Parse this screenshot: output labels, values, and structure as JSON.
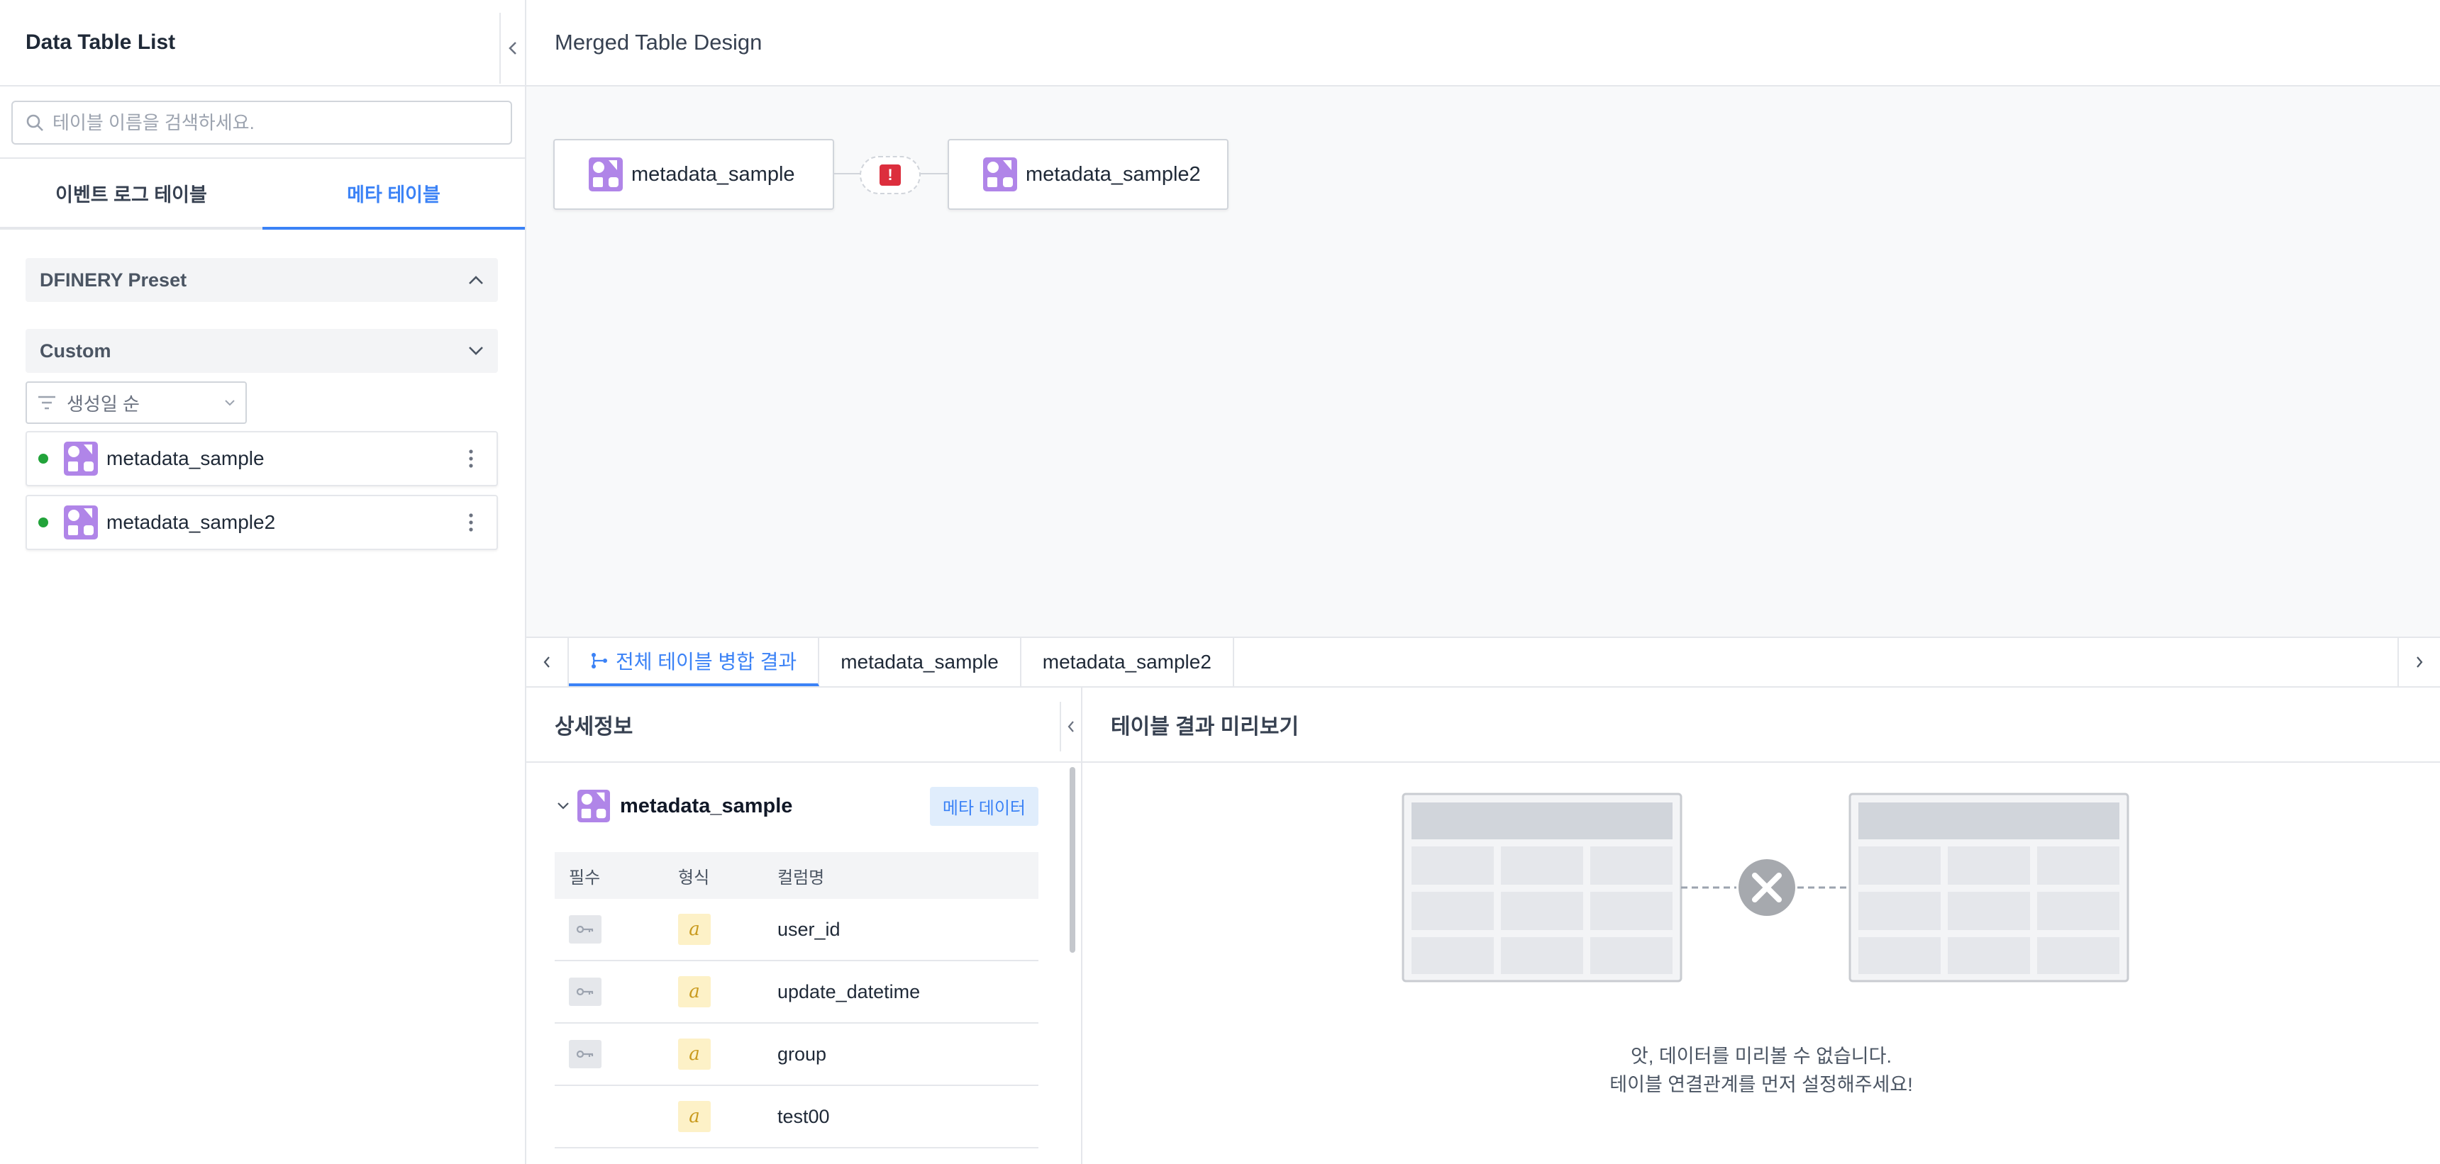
{
  "sidebar": {
    "title": "Data Table List",
    "search": {
      "placeholder": "테이블 이름을 검색하세요.",
      "value": ""
    },
    "tabs": [
      {
        "label": "이벤트 로그 테이블",
        "active": false
      },
      {
        "label": "메타 테이블",
        "active": true
      }
    ],
    "groups": [
      {
        "label": "DFINERY Preset",
        "expanded": true
      },
      {
        "label": "Custom",
        "expanded": false
      }
    ],
    "sort": {
      "label": "생성일 순"
    },
    "tables": [
      {
        "name": "metadata_sample",
        "status": "active"
      },
      {
        "name": "metadata_sample2",
        "status": "active"
      }
    ]
  },
  "main": {
    "title": "Merged Table Design",
    "canvas": {
      "nodes": [
        {
          "name": "metadata_sample"
        },
        {
          "name": "metadata_sample2"
        }
      ],
      "join_status": "error",
      "join_icon": "!"
    },
    "bottom_tabs": [
      {
        "label": "전체 테이블 병합 결과",
        "icon": "merge-icon",
        "active": true
      },
      {
        "label": "metadata_sample",
        "active": false
      },
      {
        "label": "metadata_sample2",
        "active": false
      }
    ]
  },
  "detail": {
    "title": "상세정보",
    "table_name": "metadata_sample",
    "badge": "메타 데이터",
    "columns_header": {
      "required": "필수",
      "type": "형식",
      "name": "컬럼명"
    },
    "columns": [
      {
        "required": true,
        "type": "a",
        "name": "user_id"
      },
      {
        "required": true,
        "type": "a",
        "name": "update_datetime"
      },
      {
        "required": true,
        "type": "a",
        "name": "group"
      },
      {
        "required": false,
        "type": "a",
        "name": "test00"
      }
    ]
  },
  "preview": {
    "title": "테이블 결과 미리보기",
    "message_line1": "앗, 데이터를 미리볼 수 없습니다.",
    "message_line2": "테이블 연결관계를 먼저 설정해주세요!"
  },
  "colors": {
    "accent": "#3b82f6",
    "status_active": "#22a33a",
    "error": "#dc2e3d",
    "table_icon": "#b085e8"
  }
}
